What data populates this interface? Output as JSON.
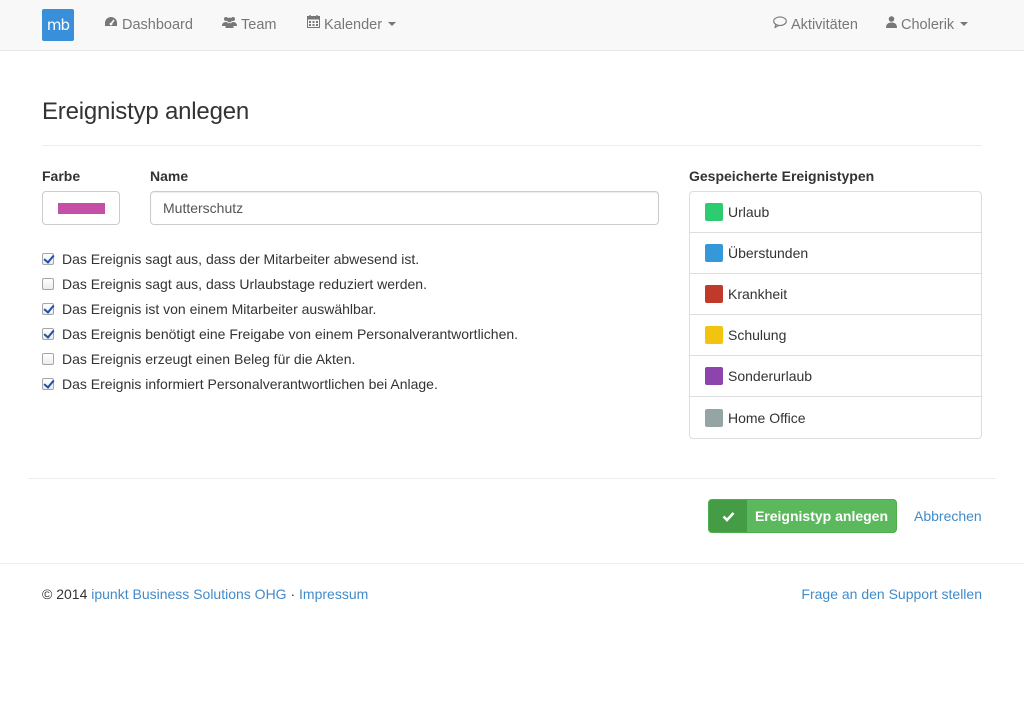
{
  "nav": {
    "logo_text": "mb",
    "dashboard": "Dashboard",
    "team": "Team",
    "kalender": "Kalender",
    "aktivitaeten": "Aktivitäten",
    "user": "Cholerik",
    "icons": {
      "dashboard": "dashboard-icon",
      "team": "users-icon",
      "kalender": "calendar-icon",
      "aktivitaeten": "comment-icon",
      "user": "user-icon"
    }
  },
  "page": {
    "title": "Ereignistyp anlegen"
  },
  "form": {
    "color_label": "Farbe",
    "color_value": "#c54fa5",
    "name_label": "Name",
    "name_value": "Mutterschutz",
    "options": [
      {
        "label": "Das Ereignis sagt aus, dass der Mitarbeiter abwesend ist.",
        "checked": true
      },
      {
        "label": "Das Ereignis sagt aus, dass Urlaubstage reduziert werden.",
        "checked": false
      },
      {
        "label": "Das Ereignis ist von einem Mitarbeiter auswählbar.",
        "checked": true
      },
      {
        "label": "Das Ereignis benötigt eine Freigabe von einem Personalverantwortlichen.",
        "checked": true
      },
      {
        "label": "Das Ereignis erzeugt einen Beleg für die Akten.",
        "checked": false
      },
      {
        "label": "Das Ereignis informiert Personalverantwortlichen bei Anlage.",
        "checked": true
      }
    ],
    "submit_label": "Ereignistyp anlegen",
    "cancel_label": "Abbrechen"
  },
  "saved": {
    "heading": "Gespeicherte Ereignistypen",
    "items": [
      {
        "label": "Urlaub",
        "color": "#2ecc71"
      },
      {
        "label": "Überstunden",
        "color": "#3498db"
      },
      {
        "label": "Krankheit",
        "color": "#c0392b"
      },
      {
        "label": "Schulung",
        "color": "#f1c40f"
      },
      {
        "label": "Sonderurlaub",
        "color": "#8e44ad"
      },
      {
        "label": "Home Office",
        "color": "#95a5a6"
      }
    ]
  },
  "footer": {
    "copyright": "© 2014",
    "company": "ipunkt Business Solutions OHG",
    "separator": "·",
    "impressum": "Impressum",
    "support": "Frage an den Support stellen"
  }
}
